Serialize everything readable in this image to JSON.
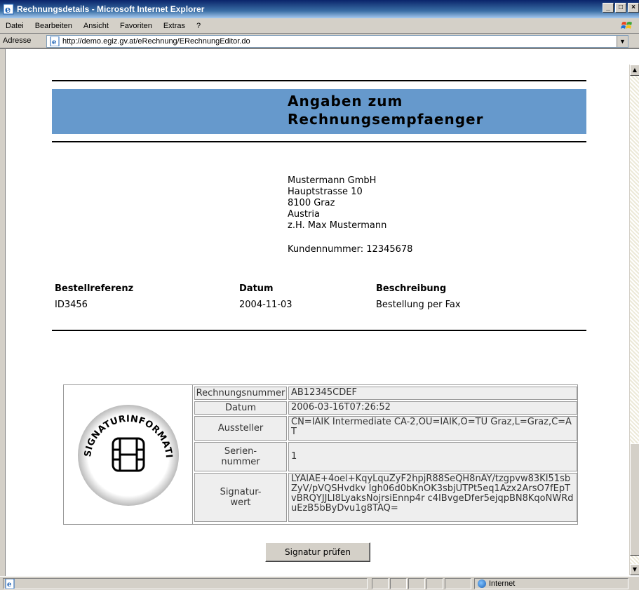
{
  "window": {
    "title": "Rechnungsdetails - Microsoft Internet Explorer",
    "controls": {
      "minimize": "_",
      "maximize": "□",
      "close": "×"
    }
  },
  "menu": {
    "items": [
      {
        "label": "Datei"
      },
      {
        "label": "Bearbeiten"
      },
      {
        "label": "Ansicht"
      },
      {
        "label": "Favoriten"
      },
      {
        "label": "Extras"
      },
      {
        "label": "?"
      }
    ]
  },
  "address_bar": {
    "label": "Adresse",
    "url": "http://demo.egiz.gv.at/eRechnung/ERechnungEditor.do"
  },
  "page": {
    "heading_line1": "Angaben zum",
    "heading_line2": "Rechnungsempfaenger",
    "recipient": {
      "company": "Mustermann GmbH",
      "street": "Hauptstrasse 10",
      "city": "8100 Graz",
      "country": "Austria",
      "attention": "z.H. Max Mustermann",
      "customer_number": "Kundennummer: 12345678"
    },
    "order": {
      "headers": {
        "reference": "Bestellreferenz",
        "date": "Datum",
        "description": "Beschreibung"
      },
      "values": {
        "reference": "ID3456",
        "date": "2004-11-03",
        "description": "Bestellung per Fax"
      }
    },
    "signature": {
      "logo_text": "SIGNATURINFORMATIONEN",
      "rows": [
        {
          "label": "Rechnungsnummer",
          "value": "AB12345CDEF"
        },
        {
          "label": "Datum",
          "value": "2006-03-16T07:26:52"
        },
        {
          "label": "Aussteller",
          "value": "CN=IAIK Intermediate CA-2,OU=IAIK,O=TU Graz,L=Graz,C=AT"
        },
        {
          "label": "Serien-\nnummer",
          "value": "1"
        },
        {
          "label": "Signatur-\nwert",
          "value": "LYAlAE+4oel+KqyLquZyF2hpjR88SeQH8nAY/tzgpvw83KI51sbZyV/pVQSHvdkv Igh06d0bKnOK3sbjUTPt5eq1Azx2ArsO7fEpTvBRQYJJLI8LyaksNojrsiEnnp4r c4IBvgeDfer5ejqpBN8KqoNWRduEzB5bByDvu1g8TAQ="
        }
      ],
      "verify_button": "Signatur prüfen"
    }
  },
  "statusbar": {
    "zone": "Internet"
  },
  "icons": [
    "ie-logo-icon",
    "windows-flag-icon",
    "page-icon",
    "chevron-down-icon",
    "scroll-up-icon",
    "scroll-down-icon",
    "globe-icon",
    "signature-seal-icon"
  ]
}
